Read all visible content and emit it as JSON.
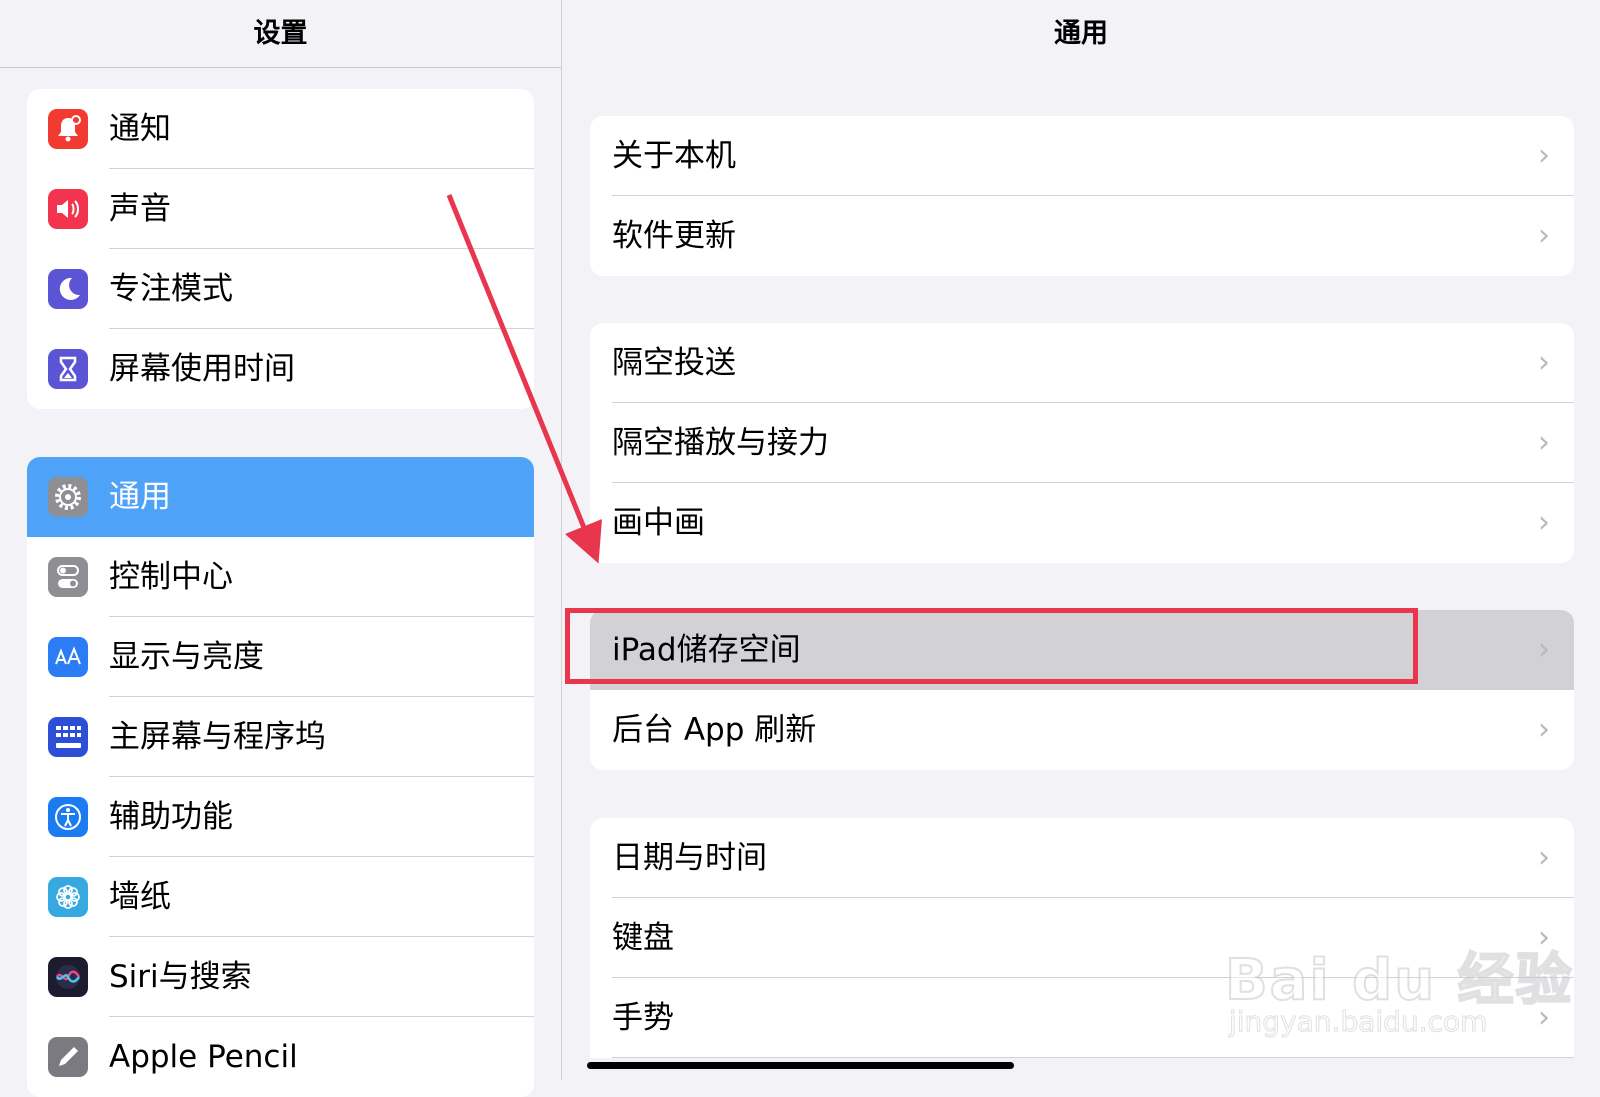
{
  "sidebar": {
    "title": "设置",
    "groups": [
      {
        "items": [
          {
            "label": "通知",
            "icon": "notification-bell-icon",
            "color": "#f23b30"
          },
          {
            "label": "声音",
            "icon": "speaker-icon",
            "color": "#f2344f"
          },
          {
            "label": "专注模式",
            "icon": "moon-icon",
            "color": "#5b55d6"
          },
          {
            "label": "屏幕使用时间",
            "icon": "hourglass-icon",
            "color": "#5b55d6"
          }
        ]
      },
      {
        "items": [
          {
            "label": "通用",
            "icon": "gear-icon",
            "color": "#8e8e93",
            "selected": true
          },
          {
            "label": "控制中心",
            "icon": "toggles-icon",
            "color": "#8e8e93"
          },
          {
            "label": "显示与亮度",
            "icon": "text-size-icon",
            "color": "#2c7cf6"
          },
          {
            "label": "主屏幕与程序坞",
            "icon": "app-grid-icon",
            "color": "#2c4fd6"
          },
          {
            "label": "辅助功能",
            "icon": "accessibility-icon",
            "color": "#1b7cf2"
          },
          {
            "label": "墙纸",
            "icon": "flower-icon",
            "color": "#36a9e0"
          },
          {
            "label": "Siri与搜索",
            "icon": "siri-icon",
            "color": "#1c1c2e"
          },
          {
            "label": "Apple Pencil",
            "icon": "pencil-icon",
            "color": "#7a7a80"
          }
        ]
      }
    ]
  },
  "main": {
    "title": "通用",
    "groups": [
      {
        "items": [
          {
            "label": "关于本机"
          },
          {
            "label": "软件更新"
          }
        ]
      },
      {
        "items": [
          {
            "label": "隔空投送"
          },
          {
            "label": "隔空播放与接力"
          },
          {
            "label": "画中画"
          }
        ]
      },
      {
        "items": [
          {
            "label": "iPad储存空间",
            "highlighted": true
          },
          {
            "label": "后台 App 刷新"
          }
        ]
      },
      {
        "items": [
          {
            "label": "日期与时间"
          },
          {
            "label": "键盘"
          },
          {
            "label": "手势"
          }
        ]
      }
    ],
    "chevron": "›"
  },
  "annotation": {
    "box_color": "#e8364f",
    "arrow_color": "#e8364f"
  },
  "watermark": {
    "main": "Bai du 经验",
    "sub": "jingyan.baidu.com"
  },
  "colors": {
    "selected_row": "#4ea3f8",
    "pressed_row": "#d1d1d6",
    "background": "#f2f2f7"
  }
}
